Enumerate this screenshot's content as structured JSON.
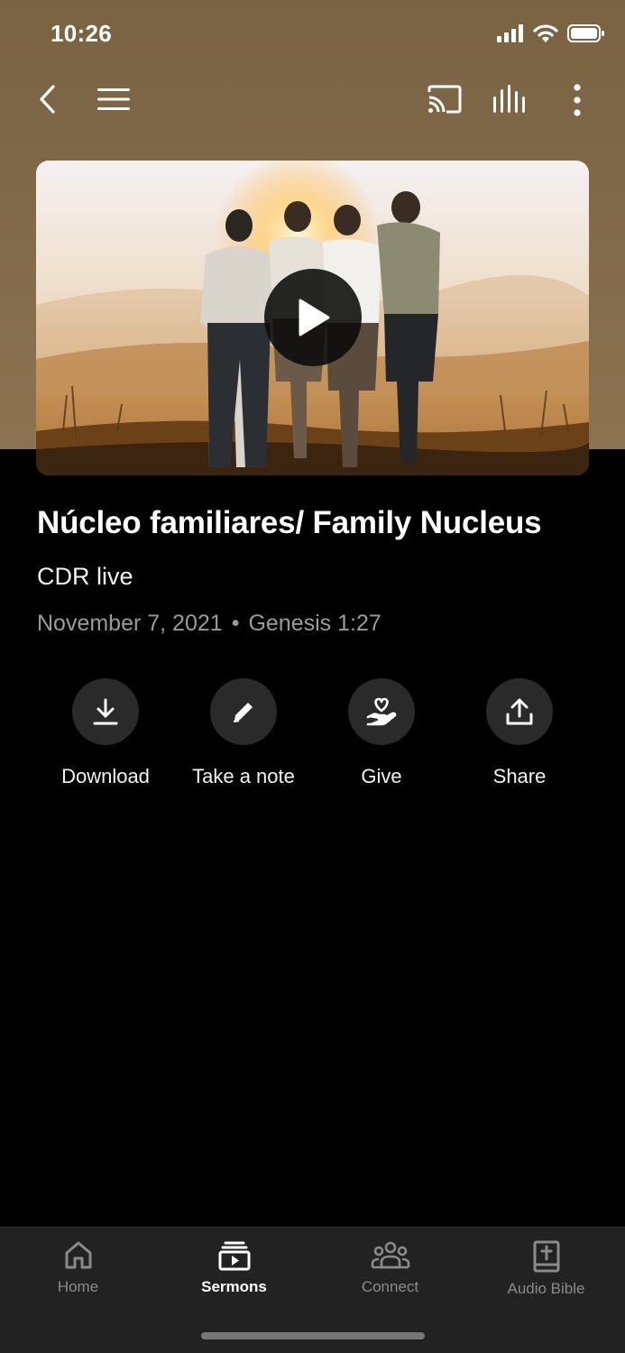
{
  "status_bar": {
    "time": "10:26"
  },
  "sermon": {
    "title": "Núcleo familiares/ Family Nucleus",
    "subtitle": "CDR live",
    "date": "November 7, 2021",
    "separator": "•",
    "scripture": "Genesis 1:27"
  },
  "actions": [
    {
      "label": "Download",
      "icon": "download-icon"
    },
    {
      "label": "Take a note",
      "icon": "pencil-icon"
    },
    {
      "label": "Give",
      "icon": "give-hand-heart-icon"
    },
    {
      "label": "Share",
      "icon": "share-upload-icon"
    }
  ],
  "tabs": [
    {
      "label": "Home",
      "icon": "home-icon",
      "active": false
    },
    {
      "label": "Sermons",
      "icon": "sermons-icon",
      "active": true
    },
    {
      "label": "Connect",
      "icon": "people-icon",
      "active": false
    },
    {
      "label": "Audio Bible",
      "icon": "bible-icon",
      "active": false
    }
  ],
  "colors": {
    "hero_top": "#7a6343",
    "background": "#000000",
    "tab_bar": "#222222",
    "action_circle": "#2a2a2a",
    "meta_text": "#9a9a9a"
  }
}
